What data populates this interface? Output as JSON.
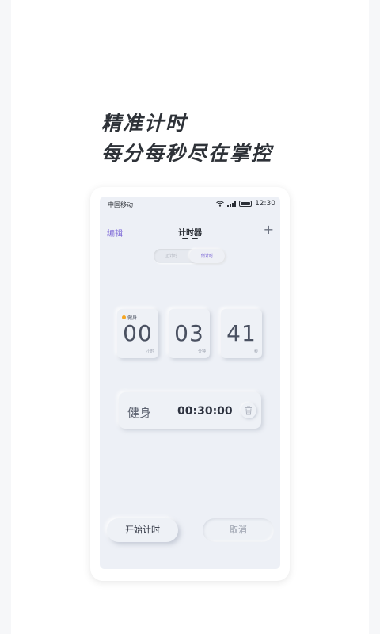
{
  "headline": {
    "line1": "精准计时",
    "line2": "每分每秒尽在掌控"
  },
  "status_bar": {
    "carrier": "中国移动",
    "time": "12:30",
    "icons": [
      "wifi-icon",
      "signal-icon",
      "battery-icon"
    ]
  },
  "nav": {
    "edit_label": "编辑",
    "title": "计时器",
    "add_icon": "plus-icon"
  },
  "segmented": {
    "left_label": "正计时",
    "right_label": "倒计时",
    "selected": "倒计时"
  },
  "timer": {
    "tag": "健身",
    "hours": "00",
    "hours_unit": "小时",
    "minutes": "03",
    "minutes_unit": "分钟",
    "seconds": "41",
    "seconds_unit": "秒"
  },
  "preset": {
    "name": "健身",
    "duration": "00:30:00",
    "delete_icon": "trash-icon"
  },
  "actions": {
    "start_label": "开始计时",
    "cancel_label": "取消"
  },
  "colors": {
    "accent": "#7b66d6",
    "tag_dot": "#f5a623",
    "screen_bg": "#edf0f6"
  }
}
